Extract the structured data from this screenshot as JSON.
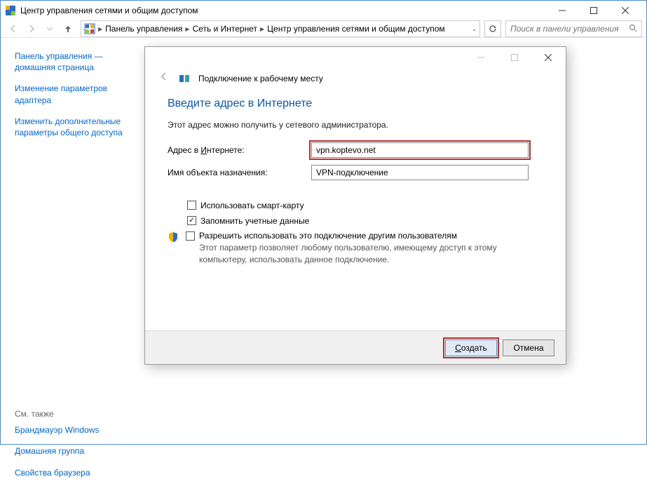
{
  "window": {
    "title": "Центр управления сетями и общим доступом"
  },
  "breadcrumb": {
    "items": [
      "Панель управления",
      "Сеть и Интернет",
      "Центр управления сетями и общим доступом"
    ]
  },
  "search": {
    "placeholder": "Поиск в панели управления"
  },
  "sidebar": {
    "home": "Панель управления — домашняя страница",
    "links": [
      "Изменение параметров адаптера",
      "Изменить дополнительные параметры общего доступа"
    ],
    "see_also_label": "См. также",
    "see_also": [
      "Брандмауэр Windows",
      "Домашняя группа",
      "Свойства браузера"
    ]
  },
  "dialog": {
    "header": "Подключение к рабочему месту",
    "title": "Введите адрес в Интернете",
    "subtitle": "Этот адрес можно получить у сетевого администратора.",
    "addr_label_pre": "Адрес в ",
    "addr_label_u": "И",
    "addr_label_post": "нтернете:",
    "addr_value": "vpn.koptevo.net",
    "name_label": "Имя объекта назначения:",
    "name_value": "VPN-подключение",
    "chk_smart_pre": "Использовать с",
    "chk_smart_u": "м",
    "chk_smart_post": "арт-карту",
    "chk_remember_u": "З",
    "chk_remember_post": "апомнить учетные данные",
    "chk_share_u": "Р",
    "chk_share_post": "азрешить использовать это подключение другим пользователям",
    "share_desc": "Этот параметр позволяет любому пользователю, имеющему доступ к этому компьютеру, использовать данное подключение.",
    "ok_u": "С",
    "ok_post": "оздать",
    "cancel": "Отмена"
  }
}
